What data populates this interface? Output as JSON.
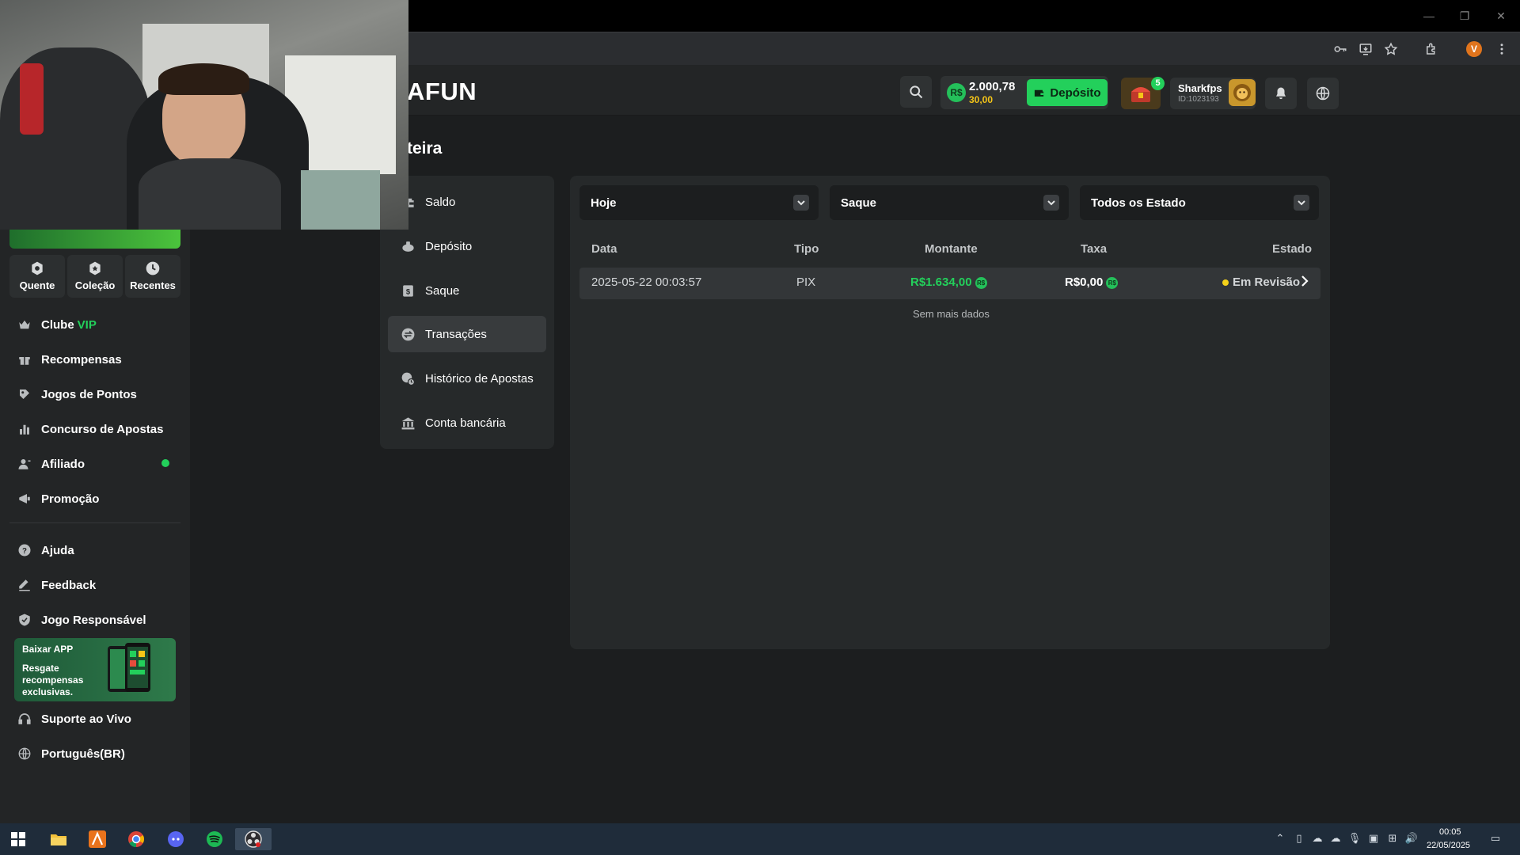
{
  "site": {
    "logo": "AFUN",
    "page_title": "teira"
  },
  "header": {
    "currency_symbol": "R$",
    "balance": "2.000,78",
    "bonus_balance": "30,00",
    "deposit_label": "Depósito",
    "chest_badge": "5",
    "username": "Sharkfps",
    "user_id": "ID:1023193"
  },
  "browser": {
    "profile_initial": "V"
  },
  "sidebar": {
    "quick_tabs": [
      {
        "label": "Quente",
        "icon": "hot-icon"
      },
      {
        "label": "Coleção",
        "icon": "collection-icon"
      },
      {
        "label": "Recentes",
        "icon": "clock-icon"
      }
    ],
    "vip_prefix": "Clube",
    "vip_accent": "VIP",
    "items": [
      {
        "label": "Recompensas",
        "icon": "gift-icon"
      },
      {
        "label": "Jogos de Pontos",
        "icon": "points-icon"
      },
      {
        "label": "Concurso de Apostas",
        "icon": "trophy-icon"
      },
      {
        "label": "Afiliado",
        "icon": "affiliate-icon"
      },
      {
        "label": "Promoção",
        "icon": "promotion-icon"
      },
      {
        "label": "Ajuda",
        "icon": "help-icon"
      },
      {
        "label": "Feedback",
        "icon": "feedback-icon"
      },
      {
        "label": "Jogo Responsável",
        "icon": "shield-icon"
      },
      {
        "label": "Suporte ao Vivo",
        "icon": "headset-icon"
      },
      {
        "label": "Português(BR)",
        "icon": "globe-icon"
      }
    ],
    "app_banner": {
      "title": "Baixar APP",
      "desc": "Resgate recompensas exclusivas."
    }
  },
  "wallet_nav": [
    {
      "label": "Saldo",
      "icon": "wallet-icon"
    },
    {
      "label": "Depósito",
      "icon": "deposit-icon"
    },
    {
      "label": "Saque",
      "icon": "withdraw-icon"
    },
    {
      "label": "Transações",
      "icon": "transactions-icon",
      "active": true
    },
    {
      "label": "Histórico de Apostas",
      "icon": "history-icon"
    },
    {
      "label": "Conta bancária",
      "icon": "bank-icon"
    }
  ],
  "filters": {
    "period": "Hoje",
    "type": "Saque",
    "status": "Todos os Estado"
  },
  "table": {
    "headers": [
      "Data",
      "Tipo",
      "Montante",
      "Taxa",
      "Estado"
    ],
    "rows": [
      {
        "date": "2025-05-22 00:03:57",
        "type": "PIX",
        "amount": "R$1.634,00",
        "fee": "R$0,00",
        "status": "Em Revisão"
      }
    ],
    "empty_more": "Sem mais dados"
  },
  "taskbar": {
    "time": "00:05",
    "date": "22/05/2025"
  },
  "colors": {
    "accent_green": "#23d05b",
    "bonus_yellow": "#f5c518",
    "status_yellow": "#f5d21a"
  }
}
